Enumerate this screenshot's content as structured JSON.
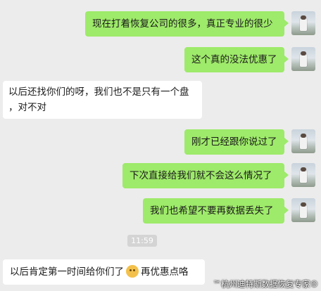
{
  "messages": [
    {
      "side": "sent",
      "text": "现在打着恢复公司的很多，真正专业的很少"
    },
    {
      "side": "sent",
      "text": "这个真的没法优惠了"
    },
    {
      "side": "recv",
      "text_line1": "以后还找你们的呀，我们也不是只有一个盘",
      "text_line2": "，对不对"
    },
    {
      "side": "sent",
      "text": "刚才已经跟你说过了"
    },
    {
      "side": "sent",
      "text": "下次直接给我们就不会这么情况了"
    },
    {
      "side": "sent",
      "text": "我们也希望不要再数据丢失了"
    },
    {
      "side": "recv",
      "text_before": "以后肯定第一时间给你们了",
      "emoji": "smile-emoji",
      "text_after": "再优惠点咯"
    }
  ],
  "timestamp": "11:59",
  "watermark": "™杭州迪特斯数据恢复专家©",
  "colors": {
    "sent_bubble": "#9eea6a",
    "recv_bubble": "#ffffff",
    "background": "#ececec"
  }
}
